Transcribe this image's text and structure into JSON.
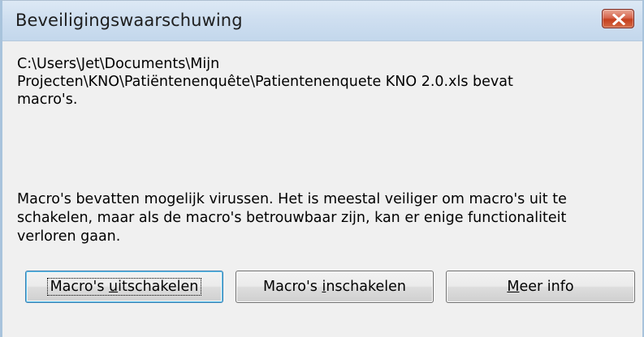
{
  "window": {
    "title": "Beveiligingswaarschuwing"
  },
  "message": {
    "path_line1": "C:\\Users\\Jet\\Documents\\Mijn",
    "path_line2": "Projecten\\KNO\\Patiëntenenquête\\Patientenenquete KNO 2.0.xls bevat",
    "path_line3": "macro's.",
    "warning_line1": "Macro's bevatten mogelijk virussen. Het is meestal veiliger om macro's uit te",
    "warning_line2": "schakelen, maar als de macro's betrouwbaar zijn, kan er enige functionaliteit",
    "warning_line3": "verloren gaan."
  },
  "buttons": {
    "disable": {
      "before": "Macro's ",
      "mnemonic": "u",
      "after": "itschakelen"
    },
    "enable": {
      "before": "Macro's ",
      "mnemonic": "i",
      "after": "nschakelen"
    },
    "info": {
      "before": "",
      "mnemonic": "M",
      "after": "eer info"
    }
  },
  "icons": {
    "close": "close-icon"
  },
  "colors": {
    "dialog_background": "#f0f0f0",
    "titlebar": "#cfdff0",
    "close_button": "#c5401f",
    "default_button_border": "#3c7fb1"
  }
}
